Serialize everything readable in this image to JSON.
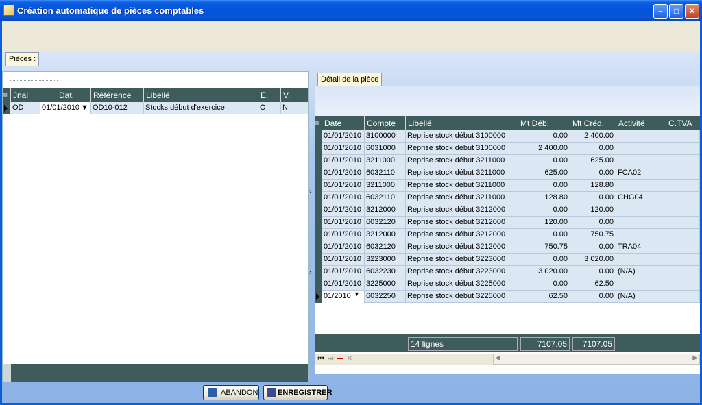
{
  "window": {
    "title": "Création automatique de pièces comptables"
  },
  "tabs": {
    "pieces": "Pièces :",
    "detail": "Détail de la pièce"
  },
  "left_grid": {
    "headers": [
      "Jnal",
      "Dat.",
      "Référence",
      "Libellé",
      "E.",
      "V."
    ],
    "row": {
      "jnal": "OD",
      "date": "01/01/2010",
      "ref": "OD10-012",
      "libelle": "Stocks début d'exercice",
      "e": "O",
      "v": "N"
    }
  },
  "right_grid": {
    "headers": [
      "Date",
      "Compte",
      "Libellé",
      "Mt Déb.",
      "Mt Créd.",
      "Activité",
      "C.TVA"
    ],
    "rows": [
      {
        "date": "01/01/2010",
        "compte": "3100000",
        "libelle": "Reprise stock début 3100000",
        "deb": "0.00",
        "cred": "2 400.00",
        "act": ""
      },
      {
        "date": "01/01/2010",
        "compte": "6031000",
        "libelle": "Reprise stock début 3100000",
        "deb": "2 400.00",
        "cred": "0.00",
        "act": ""
      },
      {
        "date": "01/01/2010",
        "compte": "3211000",
        "libelle": "Reprise stock début 3211000",
        "deb": "0.00",
        "cred": "625.00",
        "act": ""
      },
      {
        "date": "01/01/2010",
        "compte": "6032110",
        "libelle": "Reprise stock début 3211000",
        "deb": "625.00",
        "cred": "0.00",
        "act": "FCA02"
      },
      {
        "date": "01/01/2010",
        "compte": "3211000",
        "libelle": "Reprise stock début 3211000",
        "deb": "0.00",
        "cred": "128.80",
        "act": ""
      },
      {
        "date": "01/01/2010",
        "compte": "6032110",
        "libelle": "Reprise stock début 3211000",
        "deb": "128.80",
        "cred": "0.00",
        "act": "CHG04"
      },
      {
        "date": "01/01/2010",
        "compte": "3212000",
        "libelle": "Reprise stock début 3212000",
        "deb": "0.00",
        "cred": "120.00",
        "act": ""
      },
      {
        "date": "01/01/2010",
        "compte": "6032120",
        "libelle": "Reprise stock début 3212000",
        "deb": "120.00",
        "cred": "0.00",
        "act": ""
      },
      {
        "date": "01/01/2010",
        "compte": "3212000",
        "libelle": "Reprise stock début 3212000",
        "deb": "0.00",
        "cred": "750.75",
        "act": ""
      },
      {
        "date": "01/01/2010",
        "compte": "6032120",
        "libelle": "Reprise stock début 3212000",
        "deb": "750.75",
        "cred": "0.00",
        "act": "TRA04"
      },
      {
        "date": "01/01/2010",
        "compte": "3223000",
        "libelle": "Reprise stock début 3223000",
        "deb": "0.00",
        "cred": "3 020.00",
        "act": ""
      },
      {
        "date": "01/01/2010",
        "compte": "6032230",
        "libelle": "Reprise stock début 3223000",
        "deb": "3 020.00",
        "cred": "0.00",
        "act": "(N/A)"
      },
      {
        "date": "01/01/2010",
        "compte": "3225000",
        "libelle": "Reprise stock début 3225000",
        "deb": "0.00",
        "cred": "62.50",
        "act": ""
      },
      {
        "date": "01/2010",
        "compte": "6032250",
        "libelle": "Reprise stock début 3225000",
        "deb": "62.50",
        "cred": "0.00",
        "act": "(N/A)"
      }
    ],
    "footer": {
      "lines": "14 lignes",
      "total_deb": "7107.05",
      "total_cred": "7107.05"
    }
  },
  "buttons": {
    "abandon": "ABANDON",
    "save": "ENREGISTRER"
  }
}
